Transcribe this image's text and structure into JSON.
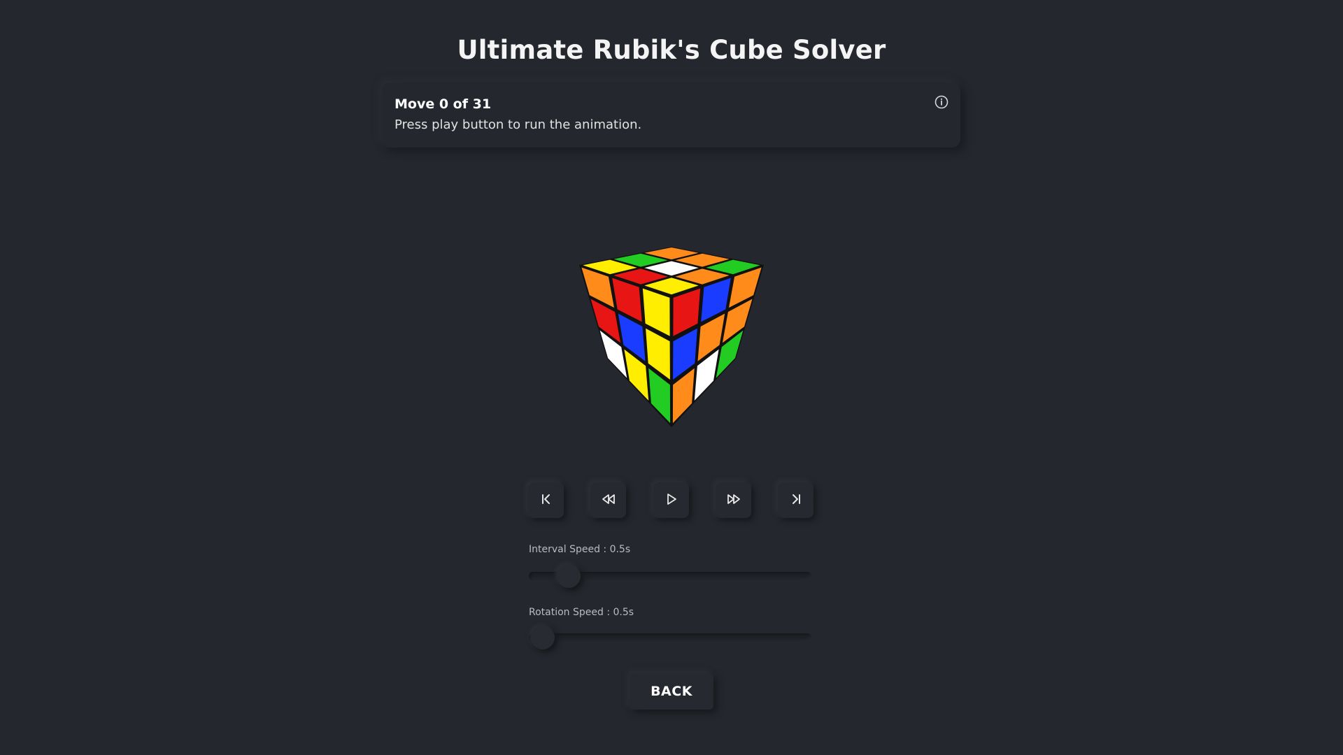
{
  "header": {
    "title": "Ultimate Rubik's Cube Solver"
  },
  "status": {
    "move_label": "Move 0 of 31",
    "description": "Press play button to run the animation.",
    "info_icon": "info-circle-icon"
  },
  "cube": {
    "top_face": [
      [
        "#ff8c1a",
        "#ff8c1a",
        "#22cc22"
      ],
      [
        "#22cc22",
        "#ffffff",
        "#ff8c1a"
      ],
      [
        "#ffee00",
        "#e81515",
        "#ffee00"
      ]
    ],
    "left_face": [
      [
        "#ff8c1a",
        "#e81515",
        "#ffee00"
      ],
      [
        "#e81515",
        "#1a3cff",
        "#ffee00"
      ],
      [
        "#ffffff",
        "#ffee00",
        "#22cc22"
      ]
    ],
    "right_face": [
      [
        "#e81515",
        "#1a3cff",
        "#ff8c1a"
      ],
      [
        "#1a3cff",
        "#ff8c1a",
        "#ff8c1a"
      ],
      [
        "#ff8c1a",
        "#ffffff",
        "#22cc22"
      ]
    ]
  },
  "controls": {
    "buttons": [
      {
        "name": "skip-to-start-button",
        "icon": "skip-start-icon"
      },
      {
        "name": "step-back-button",
        "icon": "rewind-icon"
      },
      {
        "name": "play-button",
        "icon": "play-icon"
      },
      {
        "name": "step-forward-button",
        "icon": "fast-forward-icon"
      },
      {
        "name": "skip-to-end-button",
        "icon": "skip-end-icon"
      }
    ]
  },
  "sliders": {
    "interval": {
      "label": "Interval Speed : 0.5s",
      "value_fraction": 0.14
    },
    "rotation": {
      "label": "Rotation Speed : 0.5s",
      "value_fraction": 0.05
    }
  },
  "footer": {
    "back_label": "BACK"
  },
  "colors": {
    "background": "#24272d",
    "red": "#e81515",
    "blue": "#1a3cff",
    "green": "#22cc22",
    "yellow": "#ffee00",
    "orange": "#ff8c1a",
    "white": "#ffffff"
  }
}
